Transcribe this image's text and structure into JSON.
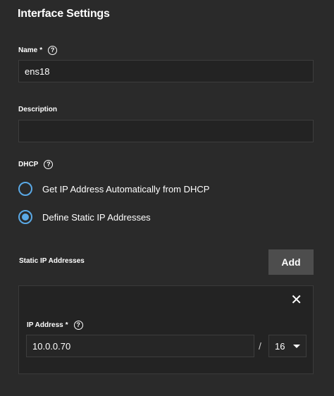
{
  "page": {
    "title": "Interface Settings"
  },
  "name_field": {
    "label": "Name",
    "required_mark": "*",
    "help_glyph": "?",
    "value": "ens18"
  },
  "description_field": {
    "label": "Description",
    "value": ""
  },
  "dhcp": {
    "label": "DHCP",
    "help_glyph": "?",
    "options": [
      {
        "label": "Get IP Address Automatically from DHCP",
        "selected": false
      },
      {
        "label": "Define Static IP Addresses",
        "selected": true
      }
    ]
  },
  "static_ips": {
    "label": "Static IP Addresses",
    "add_label": "Add",
    "close_glyph": "✕",
    "entry": {
      "label": "IP Address",
      "required_mark": "*",
      "help_glyph": "?",
      "value": "10.0.0.70",
      "separator": "/",
      "netmask": "16"
    }
  },
  "colors": {
    "background": "#2a2a2a",
    "input_bg": "#232323",
    "accent": "#5aa9e6",
    "button": "#4d4d4d"
  }
}
